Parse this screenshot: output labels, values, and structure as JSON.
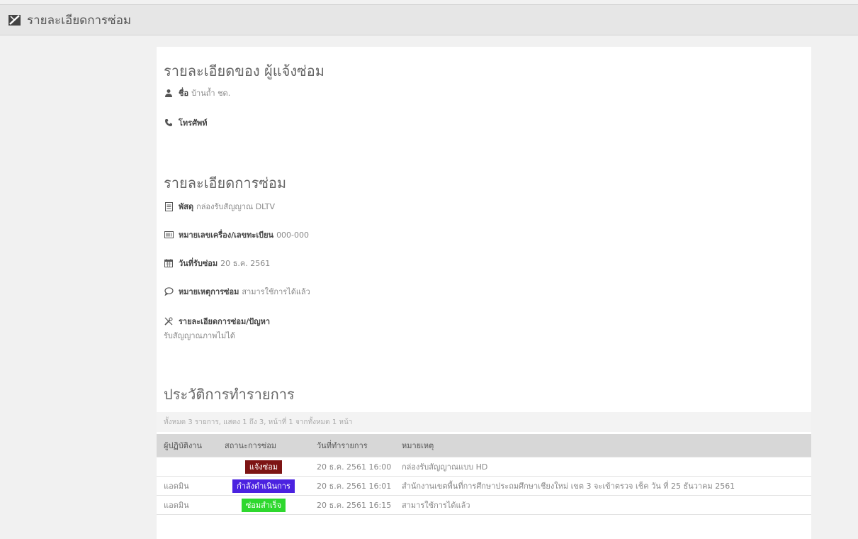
{
  "header": {
    "title": "รายละเอียดการซ่อม",
    "logo_icon": "tools-icon"
  },
  "reporter": {
    "heading": "รายละเอียดของ ผู้แจ้งซ่อม",
    "name_label": "ชื่อ",
    "name_value": "บ้านถ้ำ ชด.",
    "phone_label": "โทรศัพท์",
    "phone_value": ""
  },
  "repair": {
    "heading": "รายละเอียดการซ่อม",
    "item_label": "พัสดุ",
    "item_value": "กล่องรับสัญญาณ DLTV",
    "serial_label": "หมายเลขเครื่อง/เลขทะเบียน",
    "serial_value": "000-000",
    "date_label": "วันที่รับซ่อม",
    "date_value": "20 ธ.ค. 2561",
    "note_label": "หมายเหตุการซ่อม",
    "note_value": "สามารใช้การได้แล้ว",
    "problem_label": "รายละเอียดการซ่อม/ปัญหา",
    "problem_value": "รับสัญญาณภาพไม่ได้"
  },
  "history": {
    "heading": "ประวัติการทำรายการ",
    "summary": "ทั้งหมด 3 รายการ, แสดง 1 ถึง 3, หน้าที่ 1 จากทั้งหมด 1 หน้า",
    "columns": [
      "ผู้ปฏิบัติงาน",
      "สถานะการซ่อม",
      "วันที่ทำรายการ",
      "หมายเหตุ"
    ],
    "rows": [
      {
        "operator": "",
        "status": "แจ้งซ่อม",
        "status_color": "#7d1414",
        "date": "20 ธ.ค. 2561 16:00",
        "note": "กล่องรับสัญญาณแบบ HD"
      },
      {
        "operator": "แอดมิน",
        "status": "กำลังดำเนินการ",
        "status_color": "#4b22e0",
        "date": "20 ธ.ค. 2561 16:01",
        "note": "สำนักงานเขตพื้นที่การศึกษาประถมศึกษาเชียงใหม่ เขต 3 จะเข้าตรวจ เช็ค วัน ที่ 25 ธันวาคม 2561"
      },
      {
        "operator": "แอดมิน",
        "status": "ซ่อมสำเร็จ",
        "status_color": "#2ed82e",
        "date": "20 ธ.ค. 2561 16:15",
        "note": "สามารใช้การได้แล้ว"
      }
    ]
  }
}
